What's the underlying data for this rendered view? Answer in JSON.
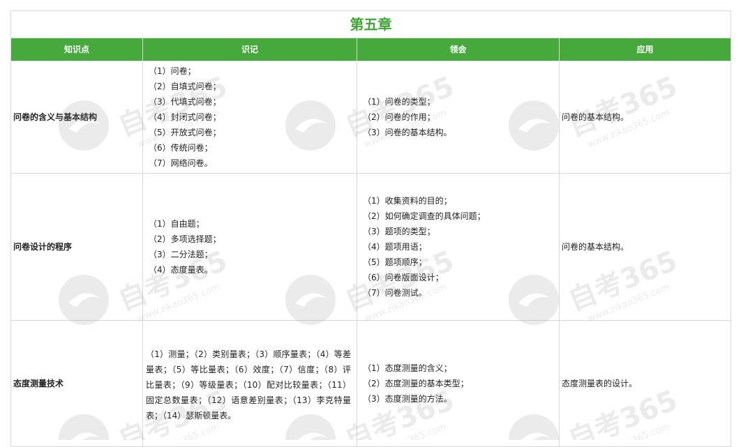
{
  "chapter_title": "第五章",
  "headers": {
    "topic": "知识点",
    "remember": "识记",
    "understand": "领会",
    "apply": "应用"
  },
  "rows": [
    {
      "topic": "问卷的含义与基本结构",
      "remember": [
        "（1）问卷；",
        "（2）自填式问卷；",
        "（3）代填式问卷；",
        "（4）封闭式问卷；",
        "（5）开放式问卷；",
        "（6）传统问卷；",
        "（7）网络问卷。"
      ],
      "understand": [
        "（1）问卷的类型；",
        "（2）问卷的作用；",
        "（3）问卷的基本结构。"
      ],
      "apply": "问卷的基本结构。"
    },
    {
      "topic": "问卷设计的程序",
      "remember": [
        "（1）自由题；",
        "（2）多项选择题；",
        "（3）二分法题；",
        "（4）态度量表。"
      ],
      "understand": [
        "（1）收集资料的目的；",
        "（2）如何确定调查的具体问题；",
        "（3）题项的类型；",
        "（4）题项用语；",
        "（5）题项顺序；",
        "（6）问卷版面设计；",
        "（7）问卷测试。"
      ],
      "apply": "问卷的基本结构。"
    },
    {
      "topic": "态度测量技术",
      "remember_paragraph": "（1）测量；（2）类别量表；（3）顺序量表；（4）等差量表；（5）等比量表；（6）效度；（7）信度；（8）评比量表；（9）等级量表；（10）配对比较量表；（11）固定总数量表；（12）语意差别量表；（13）李克特量表；（14）瑟斯顿量表。",
      "understand": [
        "（1）态度测量的含义；",
        "（2）态度测量的基本类型；",
        "（3）态度测量的方法。"
      ],
      "apply": "态度测量表的设计。"
    }
  ],
  "watermark": {
    "text": "自考365",
    "url": "www.zikao365.com"
  }
}
